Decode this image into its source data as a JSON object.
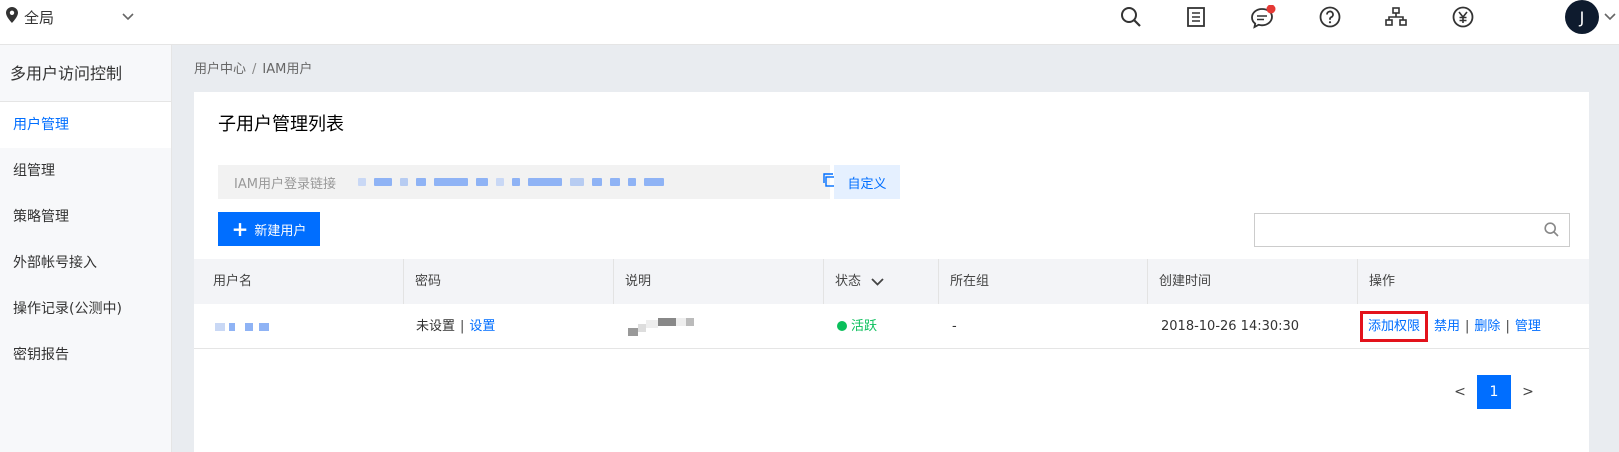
{
  "topbar": {
    "region_label": "全局",
    "icons": [
      "search-icon",
      "document-icon",
      "message-icon",
      "help-icon",
      "network-icon",
      "currency-icon"
    ],
    "notification_color": "#e53935",
    "avatar_initial": "J"
  },
  "sidebar": {
    "title": "多用户访问控制",
    "items": [
      {
        "label": "用户管理",
        "active": true
      },
      {
        "label": "组管理"
      },
      {
        "label": "策略管理"
      },
      {
        "label": "外部帐号接入"
      },
      {
        "label": "操作记录(公测中)"
      },
      {
        "label": "密钥报告"
      }
    ]
  },
  "breadcrumb": {
    "parent": "用户中心",
    "separator": "/",
    "current": "IAM用户"
  },
  "card": {
    "title": "子用户管理列表",
    "login_link_label": "IAM用户登录链接",
    "customize_button": "自定义",
    "new_user_button": "新建用户",
    "search_placeholder": ""
  },
  "table": {
    "headers": {
      "username": "用户名",
      "password": "密码",
      "description": "说明",
      "status": "状态",
      "group": "所在组",
      "created": "创建时间",
      "actions": "操作"
    },
    "rows": [
      {
        "password_state": "未设置",
        "password_action": "设置",
        "status": "活跃",
        "group": "-",
        "created": "2018-10-26 14:30:30",
        "action_add_permission": "添加权限",
        "action_disable": "禁用",
        "action_delete": "删除",
        "action_manage": "管理"
      }
    ]
  },
  "pagination": {
    "prev": "<",
    "current": "1",
    "next": ">"
  },
  "colors": {
    "accent": "#006eff",
    "status_active": "#0abf5b",
    "highlight": "#e3121b"
  }
}
